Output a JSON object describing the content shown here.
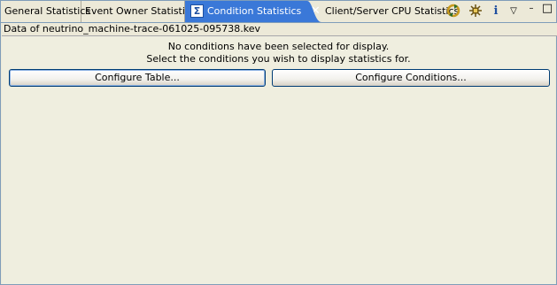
{
  "tabs": [
    {
      "label": "General Statistics"
    },
    {
      "label": "Event Owner Statistics"
    },
    {
      "label": "Condition Statistics",
      "active": true,
      "icon": "sigma-icon",
      "icon_glyph": "Σ",
      "close_glyph": "✕"
    },
    {
      "label": "Client/Server CPU Statistics"
    }
  ],
  "toolbar": {
    "sync_icon": "⟳",
    "settings_icon": "✱",
    "info_icon": "i",
    "menu_icon": "▽",
    "minimize_icon": "–",
    "maximize_icon": "□"
  },
  "info_line": "Data of neutrino_machine-trace-061025-095738.kev",
  "messages": {
    "line1": "No conditions have been selected for display.",
    "line2": "Select the conditions you wish to display statistics for."
  },
  "buttons": {
    "configure_table": "Configure Table...",
    "configure_conditions": "Configure Conditions..."
  },
  "colors": {
    "active_tab": "#3A78D8",
    "background": "#ECE9D8",
    "button_border": "#003C74"
  }
}
